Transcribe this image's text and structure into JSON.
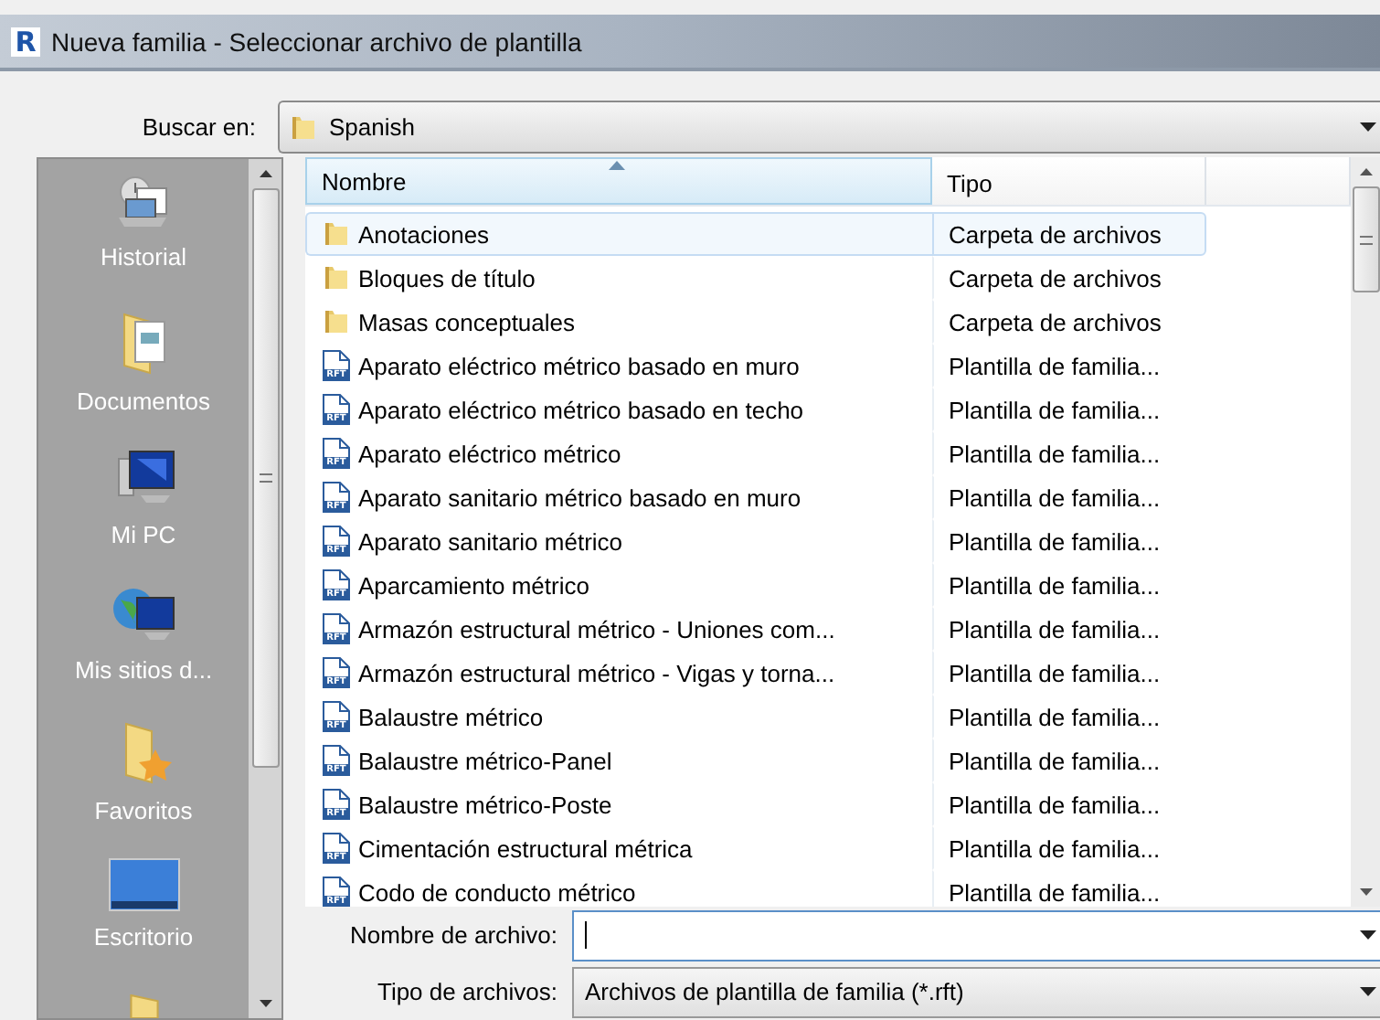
{
  "window": {
    "app_logo": "R",
    "title": "Nueva familia - Seleccionar archivo de plantilla"
  },
  "look_in": {
    "label": "Buscar en:",
    "value": "Spanish"
  },
  "sidebar": {
    "items": [
      {
        "label": "Historial",
        "kind": "history"
      },
      {
        "label": "Documentos",
        "kind": "documents"
      },
      {
        "label": "Mi PC",
        "kind": "computer"
      },
      {
        "label": "Mis sitios d...",
        "kind": "network"
      },
      {
        "label": "Favoritos",
        "kind": "favorites"
      },
      {
        "label": "Escritorio",
        "kind": "desktop"
      },
      {
        "kind": "folder"
      }
    ]
  },
  "file_list": {
    "columns": [
      {
        "label": "Nombre",
        "sorted": true
      },
      {
        "label": "Tipo",
        "sorted": false
      }
    ],
    "rows": [
      {
        "name": "Anotaciones",
        "type": "Carpeta de archivos",
        "kind": "folder",
        "selected": true
      },
      {
        "name": "Bloques de título",
        "type": "Carpeta de archivos",
        "kind": "folder",
        "selected": false
      },
      {
        "name": "Masas conceptuales",
        "type": "Carpeta de archivos",
        "kind": "folder",
        "selected": false
      },
      {
        "name": "Aparato eléctrico métrico basado en muro",
        "type": "Plantilla de familia...",
        "kind": "rft",
        "icon_text": "RFT",
        "selected": false
      },
      {
        "name": "Aparato eléctrico métrico basado en techo",
        "type": "Plantilla de familia...",
        "kind": "rft",
        "icon_text": "RFT",
        "selected": false
      },
      {
        "name": "Aparato eléctrico métrico",
        "type": "Plantilla de familia...",
        "kind": "rft",
        "icon_text": "RFT",
        "selected": false
      },
      {
        "name": "Aparato sanitario métrico basado en muro",
        "type": "Plantilla de familia...",
        "kind": "rft",
        "icon_text": "RFT",
        "selected": false
      },
      {
        "name": "Aparato sanitario métrico",
        "type": "Plantilla de familia...",
        "kind": "rft",
        "icon_text": "RFT",
        "selected": false
      },
      {
        "name": "Aparcamiento métrico",
        "type": "Plantilla de familia...",
        "kind": "rft",
        "icon_text": "RFT",
        "selected": false
      },
      {
        "name": "Armazón estructural métrico - Uniones com...",
        "type": "Plantilla de familia...",
        "kind": "rft",
        "icon_text": "RFT",
        "selected": false
      },
      {
        "name": "Armazón estructural métrico - Vigas y torna...",
        "type": "Plantilla de familia...",
        "kind": "rft",
        "icon_text": "RFT",
        "selected": false
      },
      {
        "name": "Balaustre métrico",
        "type": "Plantilla de familia...",
        "kind": "rft",
        "icon_text": "RFT",
        "selected": false
      },
      {
        "name": "Balaustre métrico-Panel",
        "type": "Plantilla de familia...",
        "kind": "rft",
        "icon_text": "RFT",
        "selected": false
      },
      {
        "name": "Balaustre métrico-Poste",
        "type": "Plantilla de familia...",
        "kind": "rft",
        "icon_text": "RFT",
        "selected": false
      },
      {
        "name": "Cimentación estructural métrica",
        "type": "Plantilla de familia...",
        "kind": "rft",
        "icon_text": "RFT",
        "selected": false
      },
      {
        "name": "Codo de conducto métrico",
        "type": "Plantilla de familia...",
        "kind": "rft",
        "icon_text": "RFT",
        "selected": false
      }
    ]
  },
  "file_name": {
    "label": "Nombre de archivo:"
  },
  "file_type": {
    "label": "Tipo de archivos:",
    "value": "Archivos de plantilla de familia  (*.rft)"
  }
}
